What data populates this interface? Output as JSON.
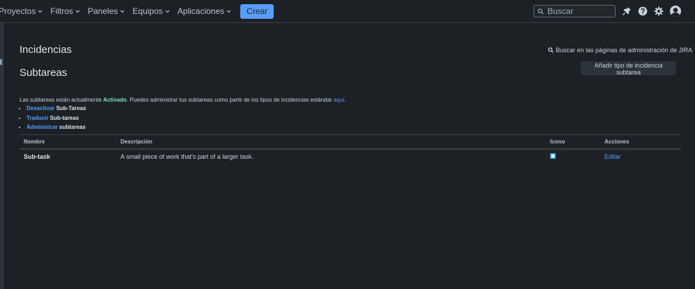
{
  "nav": {
    "items": [
      {
        "label": "Proyectos"
      },
      {
        "label": "Filtros"
      },
      {
        "label": "Paneles"
      },
      {
        "label": "Equipos"
      },
      {
        "label": "Aplicaciones"
      }
    ],
    "create_label": "Crear",
    "search_placeholder": "Buscar",
    "icons": [
      "notifications-icon",
      "help-icon",
      "settings-icon",
      "avatar"
    ]
  },
  "page": {
    "title": "Incidencias",
    "admin_search_label": "Buscar en las páginas de administración de JIRA",
    "section_title": "Subtareas",
    "add_button_label": "Añadir tipo de incidencia subtarea",
    "desc_prefix": "Las subtareas están actualmente ",
    "desc_status": "Activado",
    "desc_middle": ". Puedes administrar tus subtareas como parte de los tipos de incidencias estándar ",
    "desc_link": "aquí",
    "desc_suffix": ".",
    "links": [
      {
        "link": "Desactivar",
        "rest": " Sub-Tareas"
      },
      {
        "link": "Traducir",
        "rest": " Sub-tareas"
      },
      {
        "link": "Administrar",
        "rest": " subtareas"
      }
    ]
  },
  "table": {
    "headers": {
      "name": "Nombre",
      "description": "Descripción",
      "icon": "Icono",
      "actions": "Acciones"
    },
    "rows": [
      {
        "name": "Sub-task",
        "description": "A small piece of work that's part of a larger task.",
        "icon": "subtask-icon",
        "action": "Editar"
      }
    ]
  },
  "colors": {
    "background": "#1d2125",
    "accent": "#579dff",
    "active": "#7ee2b8"
  }
}
